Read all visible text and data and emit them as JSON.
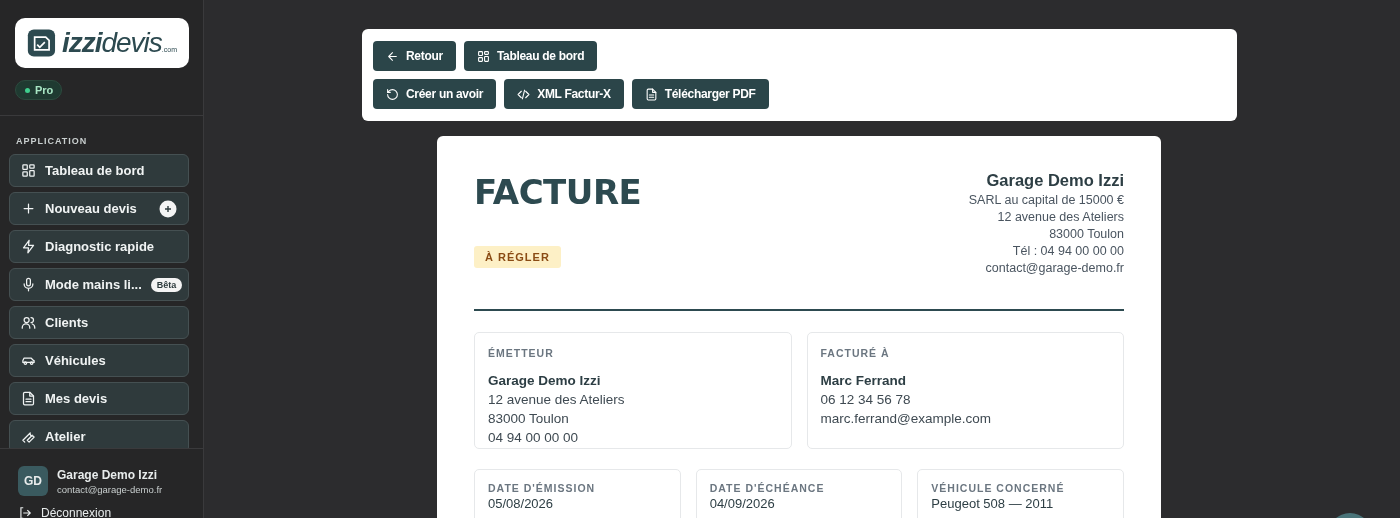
{
  "sidebar": {
    "logo": {
      "brand": "izzi",
      "suffix": "devis",
      "domain": ".com"
    },
    "plan_badge": "Pro",
    "section_label": "APPLICATION",
    "items": [
      {
        "label": "Tableau de bord"
      },
      {
        "label": "Nouveau devis",
        "kind": "plus"
      },
      {
        "label": "Diagnostic rapide"
      },
      {
        "label": "Mode mains li...",
        "kind": "tagged",
        "badge": "Bêta"
      },
      {
        "label": "Clients"
      },
      {
        "label": "Véhicules"
      },
      {
        "label": "Mes devis"
      },
      {
        "label": "Atelier"
      }
    ],
    "user": {
      "initials": "GD",
      "name": "Garage Demo Izzi",
      "email": "contact@garage-demo.fr"
    },
    "logout": "Déconnexion"
  },
  "toolbar": {
    "rows": [
      [
        {
          "label": "Retour"
        },
        {
          "label": "Tableau de bord"
        }
      ],
      [
        {
          "label": "Créer un avoir"
        },
        {
          "label": "XML Factur-X"
        },
        {
          "label": "Télécharger PDF"
        }
      ]
    ]
  },
  "invoice": {
    "title": "FACTURE",
    "status": "À RÉGLER",
    "company": {
      "name": "Garage Demo Izzi",
      "lines": [
        "SARL au capital de 15000 €",
        "12 avenue des Ateliers",
        "83000 Toulon",
        "Tél : 04 94 00 00 00",
        "contact@garage-demo.fr"
      ]
    },
    "parties": [
      {
        "label": "ÉMETTEUR",
        "name": "Garage Demo Izzi",
        "lines": [
          "12 avenue des Ateliers",
          "83000 Toulon",
          "04 94 00 00 00"
        ]
      },
      {
        "label": "FACTURÉ À",
        "name": "Marc Ferrand",
        "lines": [
          "06 12 34 56 78",
          "marc.ferrand@example.com"
        ]
      }
    ],
    "meta": [
      {
        "label": "DATE D'ÉMISSION",
        "value": "05/08/2026"
      },
      {
        "label": "DATE D'ÉCHÉANCE",
        "value": "04/09/2026"
      },
      {
        "label": "VÉHICULE CONCERNÉ",
        "value": "Peugeot 508 — 2011"
      }
    ]
  }
}
